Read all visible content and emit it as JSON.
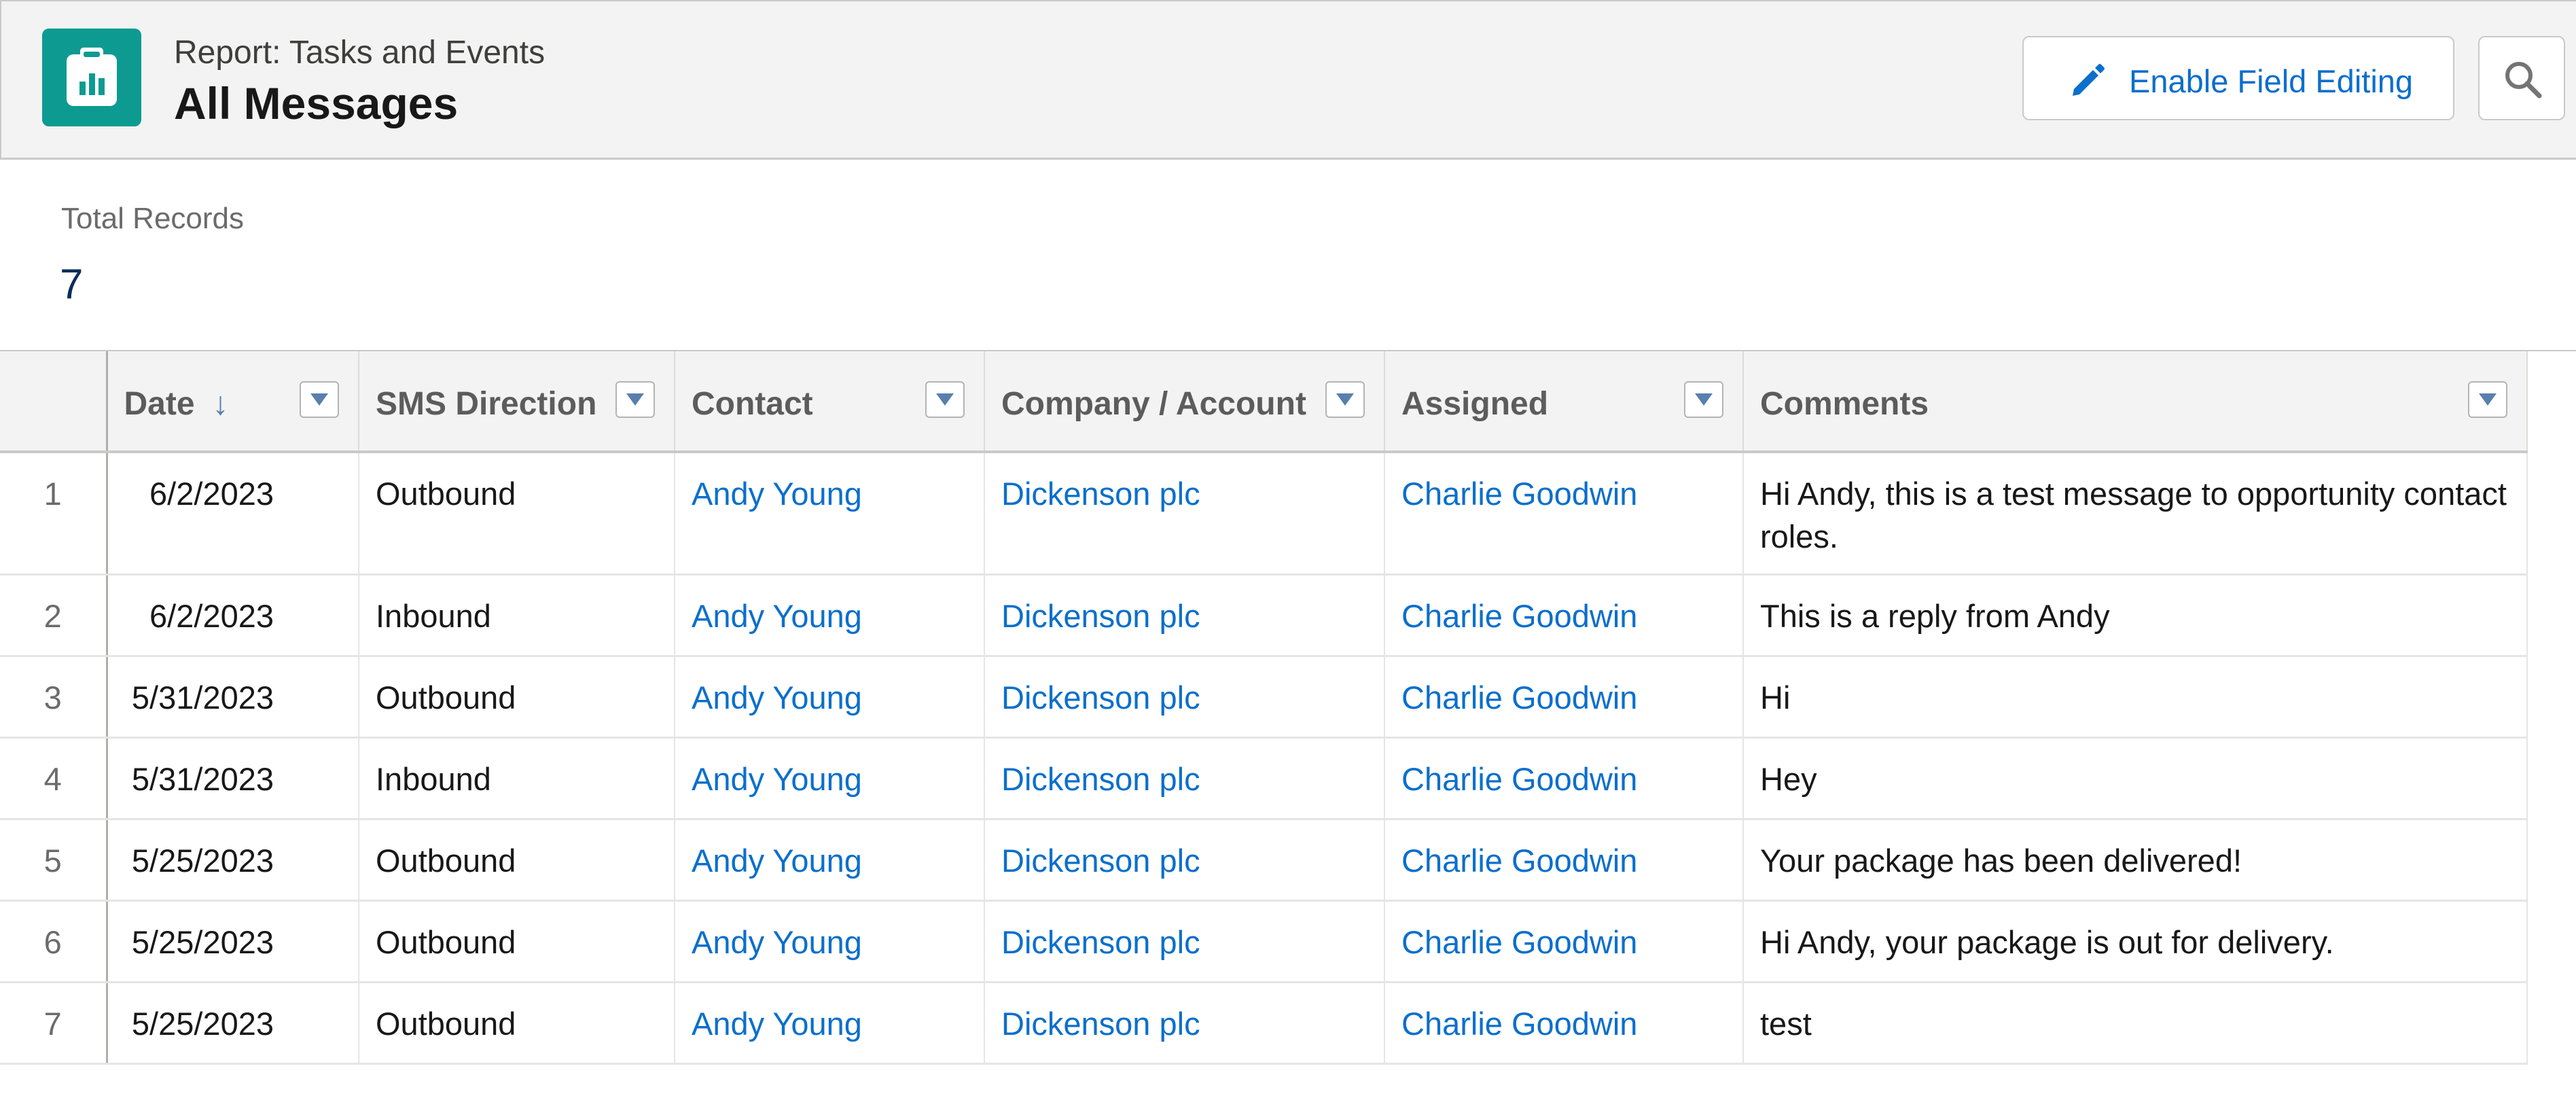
{
  "header": {
    "report_type": "Report: Tasks and Events",
    "title": "All Messages",
    "app_icon": "report-chart-icon",
    "enable_editing_label": "Enable Field Editing",
    "search_icon": "search-icon"
  },
  "summary": {
    "total_label": "Total Records",
    "total_value": "7"
  },
  "table": {
    "columns": [
      "Date",
      "SMS Direction",
      "Contact",
      "Company / Account",
      "Assigned",
      "Comments"
    ],
    "sort_indicator": "↓",
    "sorted_column": "Date",
    "rows": [
      {
        "num": "1",
        "date": "6/2/2023",
        "direction": "Outbound",
        "contact": "Andy Young",
        "account": "Dickenson plc",
        "assigned": "Charlie Goodwin",
        "comments": "Hi Andy, this is a test message to opportunity contact roles."
      },
      {
        "num": "2",
        "date": "6/2/2023",
        "direction": "Inbound",
        "contact": "Andy Young",
        "account": "Dickenson plc",
        "assigned": "Charlie Goodwin",
        "comments": "This is a reply from Andy"
      },
      {
        "num": "3",
        "date": "5/31/2023",
        "direction": "Outbound",
        "contact": "Andy Young",
        "account": "Dickenson plc",
        "assigned": "Charlie Goodwin",
        "comments": "Hi"
      },
      {
        "num": "4",
        "date": "5/31/2023",
        "direction": "Inbound",
        "contact": "Andy Young",
        "account": "Dickenson plc",
        "assigned": "Charlie Goodwin",
        "comments": "Hey"
      },
      {
        "num": "5",
        "date": "5/25/2023",
        "direction": "Outbound",
        "contact": "Andy Young",
        "account": "Dickenson plc",
        "assigned": "Charlie Goodwin",
        "comments": "Your package has been delivered!"
      },
      {
        "num": "6",
        "date": "5/25/2023",
        "direction": "Outbound",
        "contact": "Andy Young",
        "account": "Dickenson plc",
        "assigned": "Charlie Goodwin",
        "comments": "Hi Andy, your package is out for delivery."
      },
      {
        "num": "7",
        "date": "5/25/2023",
        "direction": "Outbound",
        "contact": "Andy Young",
        "account": "Dickenson plc",
        "assigned": "Charlie Goodwin",
        "comments": "test"
      }
    ]
  },
  "colors": {
    "brand_teal": "#0d9b91",
    "link_blue": "#0b6fcc",
    "header_bg": "#f3f3f3",
    "total_value": "#0b2d5a"
  }
}
